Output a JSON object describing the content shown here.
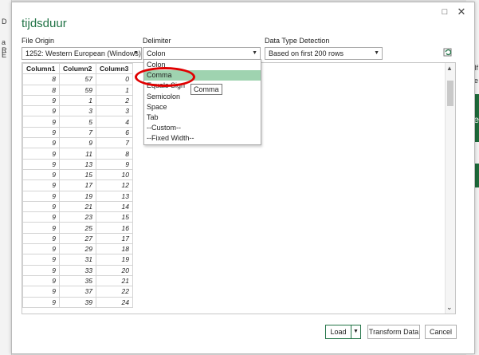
{
  "background": {
    "left_glyphs": [
      "D",
      "a R",
      "E"
    ],
    "right_glyphs": [
      "lf",
      "pre",
      "ne"
    ]
  },
  "dialog": {
    "title": "tijdsduur",
    "restore_glyph": "□",
    "close_glyph": "✕"
  },
  "fields": {
    "file_origin": {
      "label": "File Origin",
      "value": "1252: Western European (Windows)"
    },
    "delimiter": {
      "label": "Delimiter",
      "value": "Colon"
    },
    "detection": {
      "label": "Data Type Detection",
      "value": "Based on first 200 rows"
    }
  },
  "delimiter_options": [
    "Colon",
    "Comma",
    "Equals Sign",
    "Semicolon",
    "Space",
    "Tab",
    "--Custom--",
    "--Fixed Width--"
  ],
  "highlighted_option": "Comma",
  "tooltip": "Comma",
  "table": {
    "columns": [
      "Column1",
      "Column2",
      "Column3"
    ],
    "rows": [
      [
        "8",
        "57",
        "0"
      ],
      [
        "8",
        "59",
        "1"
      ],
      [
        "9",
        "1",
        "2"
      ],
      [
        "9",
        "3",
        "3"
      ],
      [
        "9",
        "5",
        "4"
      ],
      [
        "9",
        "7",
        "6"
      ],
      [
        "9",
        "9",
        "7"
      ],
      [
        "9",
        "11",
        "8"
      ],
      [
        "9",
        "13",
        "9"
      ],
      [
        "9",
        "15",
        "10"
      ],
      [
        "9",
        "17",
        "12"
      ],
      [
        "9",
        "19",
        "13"
      ],
      [
        "9",
        "21",
        "14"
      ],
      [
        "9",
        "23",
        "15"
      ],
      [
        "9",
        "25",
        "16"
      ],
      [
        "9",
        "27",
        "17"
      ],
      [
        "9",
        "29",
        "18"
      ],
      [
        "9",
        "31",
        "19"
      ],
      [
        "9",
        "33",
        "20"
      ],
      [
        "9",
        "35",
        "21"
      ],
      [
        "9",
        "37",
        "22"
      ],
      [
        "9",
        "39",
        "24"
      ]
    ]
  },
  "buttons": {
    "load": "Load",
    "transform": "Transform Data",
    "cancel": "Cancel"
  },
  "colors": {
    "accent": "#217346",
    "selection": "#9fd3b0",
    "annotation": "#e00000"
  }
}
